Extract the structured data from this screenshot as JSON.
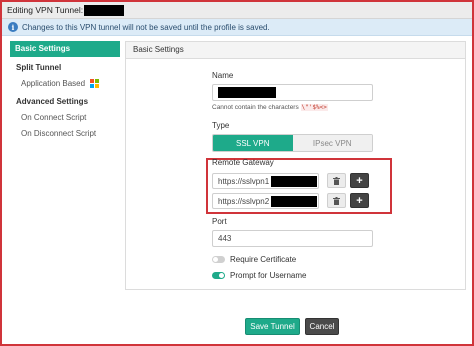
{
  "window": {
    "title": "Editing VPN Tunnel:"
  },
  "info": {
    "message": "Changes to this VPN tunnel will not be saved until the profile is saved."
  },
  "sidebar": {
    "basic_settings": "Basic Settings",
    "split_tunnel": "Split Tunnel",
    "application_based": "Application Based",
    "advanced_settings": "Advanced Settings",
    "on_connect_script": "On Connect Script",
    "on_disconnect_script": "On Disconnect Script"
  },
  "panel": {
    "header": "Basic Settings",
    "name_label": "Name",
    "name_hint_prefix": "Cannot contain the characters",
    "name_hint_chars": "\\\"'$%<>",
    "type_label": "Type",
    "type_options": [
      "SSL VPN",
      "IPsec VPN"
    ],
    "type_selected": "SSL VPN",
    "gateway_label": "Remote Gateway",
    "gateways": [
      {
        "prefix": "https://sslvpn1"
      },
      {
        "prefix": "https://sslvpn2"
      }
    ],
    "port_label": "Port",
    "port_value": "443",
    "require_certificate_label": "Require Certificate",
    "require_certificate_on": false,
    "prompt_username_label": "Prompt for Username",
    "prompt_username_on": true
  },
  "footer": {
    "save_label": "Save Tunnel",
    "cancel_label": "Cancel"
  },
  "colors": {
    "accent": "#1eaa8a",
    "highlight": "#d0343a",
    "info_bg": "#dcebf7"
  },
  "icons": [
    "info-icon",
    "windows-logo-icon",
    "trash-icon",
    "plus-icon"
  ]
}
